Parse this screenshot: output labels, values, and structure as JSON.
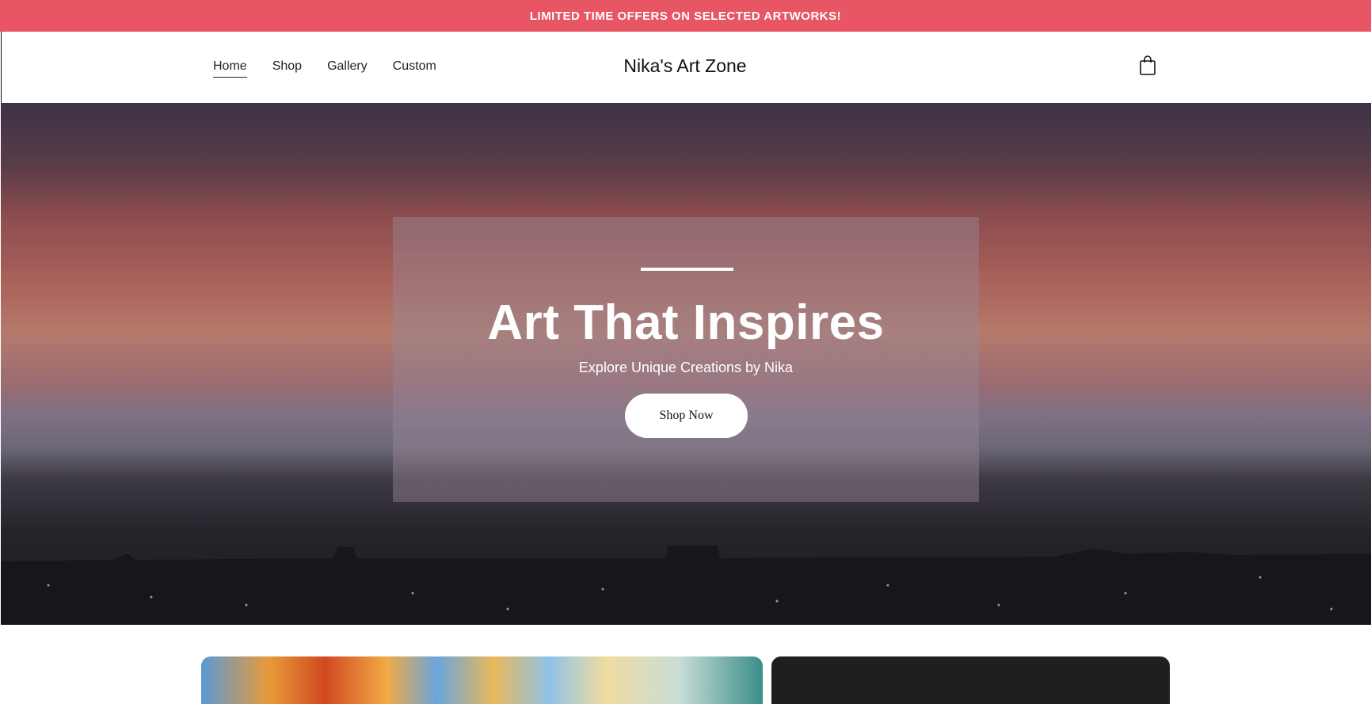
{
  "promo": {
    "text": "LIMITED TIME OFFERS ON SELECTED ARTWORKS!"
  },
  "nav": {
    "items": [
      {
        "label": "Home"
      },
      {
        "label": "Shop"
      },
      {
        "label": "Gallery"
      },
      {
        "label": "Custom"
      }
    ]
  },
  "brand": {
    "name": "Nika's Art Zone"
  },
  "cart": {
    "icon": "shopping-bag-icon"
  },
  "hero": {
    "title": "Art That Inspires",
    "subtitle": "Explore Unique Creations by Nika",
    "cta": "Shop Now"
  },
  "colors": {
    "promo_bg": "#e85565",
    "text_dark": "#111111",
    "white": "#ffffff"
  }
}
